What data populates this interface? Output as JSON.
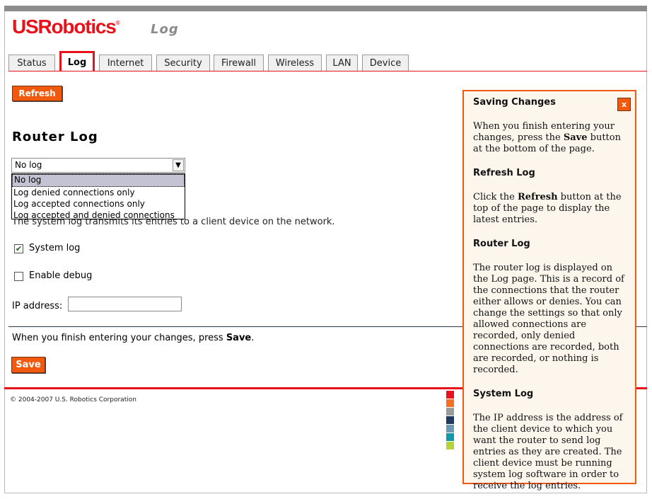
{
  "brand": {
    "logo": "USRobotics",
    "reg": "®",
    "page_heading": "Log"
  },
  "tabs": [
    {
      "label": "Status"
    },
    {
      "label": "Log",
      "active": true
    },
    {
      "label": "Internet"
    },
    {
      "label": "Security"
    },
    {
      "label": "Firewall"
    },
    {
      "label": "Wireless"
    },
    {
      "label": "LAN"
    },
    {
      "label": "Device"
    }
  ],
  "refresh_label": "Refresh",
  "router_log_title": "Router Log",
  "log_select": {
    "value": "No log",
    "options": [
      "No log",
      "Log denied connections only",
      "Log accepted connections only",
      "Log accepted and denied connections"
    ]
  },
  "description": "The system log transmits its entries to a client device on the network.",
  "system_log": {
    "label": "System log",
    "checked": true
  },
  "enable_debug": {
    "label": "Enable debug",
    "checked": false
  },
  "ip_address": {
    "label": "IP address:",
    "value": ""
  },
  "finish_text": {
    "prefix": "When you finish entering your changes, press ",
    "bold": "Save",
    "suffix": "."
  },
  "save_label": "Save",
  "copyright": "© 2004-2007 U.S. Robotics Corporation",
  "swatch_colors": [
    "#e8121c",
    "#f36f21",
    "#9b9b9b",
    "#1f3a5f",
    "#6c98b0",
    "#1497a9",
    "#b8d23a"
  ],
  "help": {
    "close": "x",
    "sections": [
      {
        "title": "Saving Changes",
        "text": [
          [
            "When you finish entering your changes, press the ",
            false
          ],
          [
            "Save",
            true
          ],
          [
            " button at the bottom of the page.",
            false
          ]
        ]
      },
      {
        "title": "Refresh Log",
        "text": [
          [
            "Click the ",
            false
          ],
          [
            "Refresh",
            true
          ],
          [
            " button at the top of the page to display the latest entries.",
            false
          ]
        ]
      },
      {
        "title": "Router Log",
        "text": [
          [
            "The router log is displayed on the Log page. This is a record of the connections that the router either allows or denies. You can change the settings so that only allowed connections are recorded, only denied connections are recorded, both are recorded, or nothing is recorded.",
            false
          ]
        ]
      },
      {
        "title": "System Log",
        "text": [
          [
            "The IP address is the address of the client device to which you want the router to send log entries as they are created. The client device must be running system log software in order to receive the log entries.",
            false
          ]
        ]
      }
    ]
  }
}
